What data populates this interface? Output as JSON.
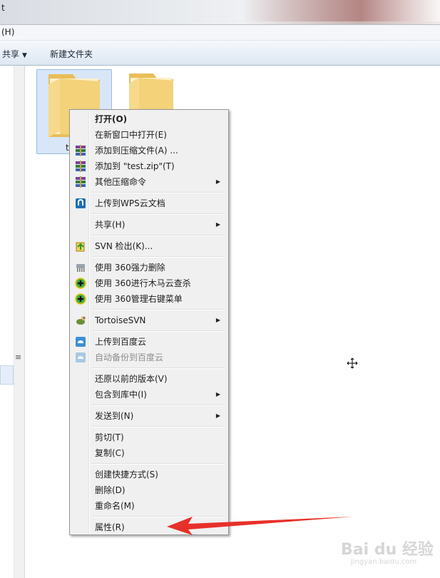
{
  "window": {
    "title_fragment": "t",
    "menu_fragment": "(H)"
  },
  "toolbar": {
    "share_label": "共享",
    "new_folder_label": "新建文件夹"
  },
  "files": [
    {
      "name": "t",
      "selected": true
    },
    {
      "name": "",
      "selected": false
    }
  ],
  "context_menu": {
    "groups": [
      [
        {
          "label": "打开(O)",
          "bold": true,
          "icon": "none"
        },
        {
          "label": "在新窗口中打开(E)",
          "icon": "none"
        },
        {
          "label": "添加到压缩文件(A) ...",
          "icon": "winrar-icon"
        },
        {
          "label": "添加到 \"test.zip\"(T)",
          "icon": "winrar-icon"
        },
        {
          "label": "其他压缩命令",
          "icon": "winrar-icon",
          "submenu": true
        }
      ],
      [
        {
          "label": "上传到WPS云文档",
          "icon": "wps-cloud-icon"
        }
      ],
      [
        {
          "label": "共享(H)",
          "icon": "none",
          "submenu": true
        }
      ],
      [
        {
          "label": "SVN 检出(K)...",
          "icon": "svn-checkout-icon"
        }
      ],
      [
        {
          "label": "使用 360强力删除",
          "icon": "shredder-icon"
        },
        {
          "label": "使用 360进行木马云查杀",
          "icon": "360-plus-icon"
        },
        {
          "label": "使用 360管理右键菜单",
          "icon": "360-plus-icon"
        }
      ],
      [
        {
          "label": "TortoiseSVN",
          "icon": "tortoise-icon",
          "submenu": true
        }
      ],
      [
        {
          "label": "上传到百度云",
          "icon": "baidu-cloud-icon"
        },
        {
          "label": "自动备份到百度云",
          "icon": "baidu-cloud-icon",
          "disabled": true
        }
      ],
      [
        {
          "label": "还原以前的版本(V)",
          "icon": "none"
        },
        {
          "label": "包含到库中(I)",
          "icon": "none",
          "submenu": true
        }
      ],
      [
        {
          "label": "发送到(N)",
          "icon": "none",
          "submenu": true
        }
      ],
      [
        {
          "label": "剪切(T)",
          "icon": "none"
        },
        {
          "label": "复制(C)",
          "icon": "none"
        }
      ],
      [
        {
          "label": "创建快捷方式(S)",
          "icon": "none"
        },
        {
          "label": "删除(D)",
          "icon": "none"
        },
        {
          "label": "重命名(M)",
          "icon": "none"
        }
      ],
      [
        {
          "label": "属性(R)",
          "icon": "none"
        }
      ]
    ]
  },
  "annotation": {
    "arrow_color": "#e8302b",
    "points_to": "属性(R)"
  },
  "watermark": {
    "text": "Bai du 经验",
    "sub": "jingyan.baidu.com"
  },
  "colors": {
    "menu_bg": "#f0f0f0",
    "selection": "#d8e6f8",
    "folder": "#f3d27a"
  }
}
